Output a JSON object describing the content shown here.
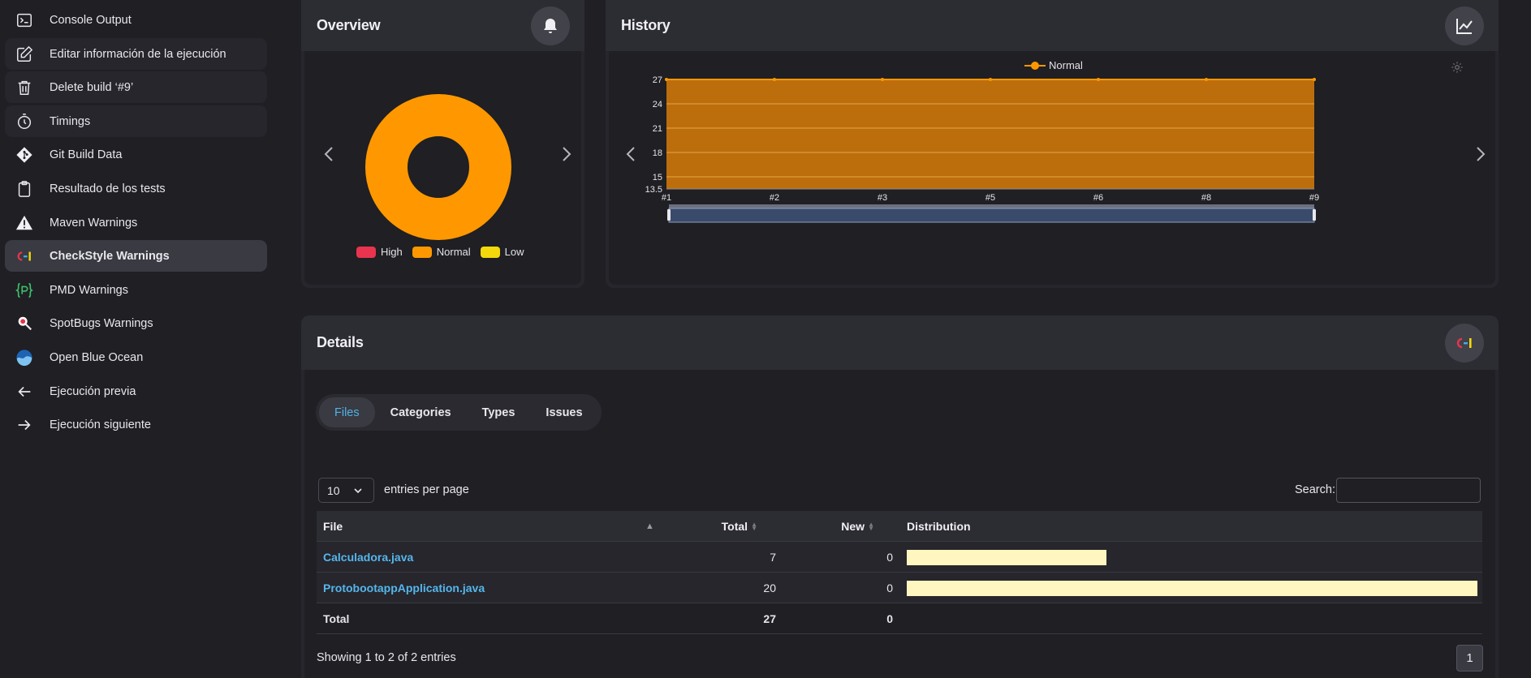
{
  "sidebar": {
    "items": [
      {
        "label": "Console Output",
        "icon": "terminal-icon"
      },
      {
        "label": "Editar información de la ejecución",
        "icon": "edit-icon"
      },
      {
        "label": "Delete build ‘#9’",
        "icon": "trash-icon"
      },
      {
        "label": "Timings",
        "icon": "stopwatch-icon"
      },
      {
        "label": "Git Build Data",
        "icon": "git-icon"
      },
      {
        "label": "Resultado de los tests",
        "icon": "clipboard-icon"
      },
      {
        "label": "Maven Warnings",
        "icon": "warning-icon"
      },
      {
        "label": "CheckStyle Warnings",
        "icon": "checkstyle-icon"
      },
      {
        "label": "PMD Warnings",
        "icon": "pmd-icon"
      },
      {
        "label": "SpotBugs Warnings",
        "icon": "spotbugs-icon"
      },
      {
        "label": "Open Blue Ocean",
        "icon": "blue-ocean-icon"
      },
      {
        "label": "Ejecución previa",
        "icon": "arrow-left-icon"
      },
      {
        "label": "Ejecución siguiente",
        "icon": "arrow-right-icon"
      }
    ]
  },
  "overview": {
    "title": "Overview",
    "legend": [
      {
        "label": "High",
        "color": "#e8344e"
      },
      {
        "label": "Normal",
        "color": "#ff9800"
      },
      {
        "label": "Low",
        "color": "#f5d90a"
      }
    ]
  },
  "history": {
    "title": "History",
    "legend_label": "Normal"
  },
  "chart_data": [
    {
      "type": "pie",
      "labels": [
        "High",
        "Normal",
        "Low"
      ],
      "values": [
        0,
        27,
        0
      ],
      "colors": [
        "#e8344e",
        "#ff9800",
        "#f5d90a"
      ],
      "legend": "bottom"
    },
    {
      "type": "area",
      "categories": [
        "#1",
        "#2",
        "#3",
        "#5",
        "#6",
        "#8",
        "#9"
      ],
      "series": [
        {
          "name": "Normal",
          "values": [
            27,
            27,
            27,
            27,
            27,
            27,
            27
          ],
          "color": "#ff9800"
        }
      ],
      "y_ticks": [
        "13.5",
        "15",
        "18",
        "21",
        "24",
        "27"
      ],
      "ylim": [
        13.5,
        27
      ],
      "legend": "top-center",
      "grid": true
    }
  ],
  "details": {
    "title": "Details",
    "tabs": [
      "Files",
      "Categories",
      "Types",
      "Issues"
    ],
    "page_size": "10",
    "entries_label": "entries per page",
    "search_label": "Search:",
    "columns": [
      "File",
      "Total",
      "New",
      "Distribution"
    ],
    "rows": [
      {
        "file": "Calculadora.java",
        "total": "7",
        "new": "0",
        "fraction": 0.35
      },
      {
        "file": "ProtobootappApplication.java",
        "total": "20",
        "new": "0",
        "fraction": 1.0
      }
    ],
    "footer": {
      "label": "Total",
      "total": "27",
      "new": "0"
    },
    "showing": "Showing 1 to 2 of 2 entries",
    "page": "1"
  }
}
